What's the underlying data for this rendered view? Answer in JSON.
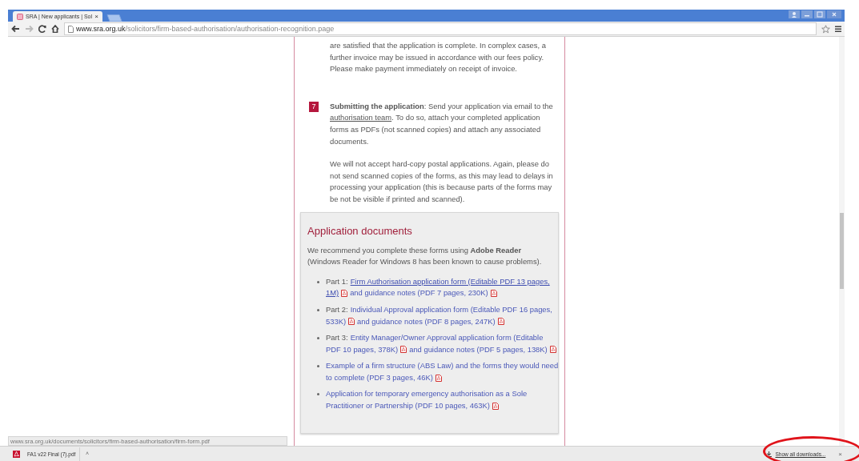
{
  "browser": {
    "tab_title": "SRA | New applicants | Sol",
    "url_host": "www.sra.org.uk",
    "url_path": "/solicitors/firm-based-authorisation/authorisation-recognition.page"
  },
  "content": {
    "intro_paragraph": "are satisfied that the application is complete. In complex cases, a further invoice may be issued in accordance with our fees policy. Please make payment immediately on receipt of invoice.",
    "step": {
      "number": "7",
      "lead": "**Submitting the application**: Send your application via email to the",
      "link": "authorisation team",
      "rest": ". To do so, attach your completed application forms as PDFs (not scanned copies) and attach any associated documents."
    },
    "step_note": "We will not accept hard-copy postal applications. Again, please do not send scanned copies of the forms, as this may lead to delays in processing your application (this is because parts of the forms may be not be visible if printed and scanned).",
    "documents": {
      "title": "Application documents",
      "intro": "We recommend you complete these forms using **Adobe Reader** (Windows Reader for Windows 8 has been known to cause problems).",
      "items": [
        {
          "lines": [
            [
              {
                "kind": "text",
                "text": "Part 1: "
              },
              {
                "kind": "link",
                "text": "Firm Authorisation application form (Editable PDF 13 pages,",
                "hover": true
              }
            ],
            [
              {
                "kind": "link",
                "text": "1M)",
                "hover": true
              },
              {
                "kind": "pdf"
              },
              {
                "kind": "link",
                "text": "and guidance notes (PDF 7 pages, 230K)",
                "hover": false
              },
              {
                "kind": "pdf"
              }
            ]
          ]
        },
        {
          "lines": [
            [
              {
                "kind": "text",
                "text": "Part 2: "
              },
              {
                "kind": "link",
                "text": "Individual Approval application form (Editable PDF 16 pages,",
                "hover": false
              }
            ],
            [
              {
                "kind": "link",
                "text": "533K)",
                "hover": false
              },
              {
                "kind": "pdf"
              },
              {
                "kind": "link",
                "text": "and guidance notes (PDF 8 pages, 247K)",
                "hover": false
              },
              {
                "kind": "pdf"
              }
            ]
          ]
        },
        {
          "lines": [
            [
              {
                "kind": "text",
                "text": "Part 3: "
              },
              {
                "kind": "link",
                "text": "Entity Manager/Owner Approval application form (Editable",
                "hover": false
              }
            ],
            [
              {
                "kind": "link",
                "text": "PDF 10 pages, 378K)",
                "hover": false
              },
              {
                "kind": "pdf"
              },
              {
                "kind": "link",
                "text": "and guidance notes (PDF 5 pages, 138K)",
                "hover": false
              },
              {
                "kind": "pdf"
              }
            ]
          ]
        },
        {
          "lines": [
            [
              {
                "kind": "link",
                "text": "Example of a firm structure (ABS Law) and the forms they would need",
                "hover": false
              }
            ],
            [
              {
                "kind": "link",
                "text": "to complete (PDF 3 pages, 46K)",
                "hover": false
              },
              {
                "kind": "pdf"
              }
            ]
          ]
        },
        {
          "lines": [
            [
              {
                "kind": "link",
                "text": "Application for temporary emergency authorisation as a Sole",
                "hover": false
              }
            ],
            [
              {
                "kind": "link",
                "text": "Practitioner or Partnership (PDF 10 pages, 463K)",
                "hover": false
              },
              {
                "kind": "pdf"
              }
            ]
          ]
        }
      ]
    }
  },
  "status_url": "www.sra.org.uk/documents/solicitors/firm-based-authorisation/firm-form.pdf",
  "downloads": {
    "file": "FA1 v22 Final (7).pdf",
    "caret": "˄",
    "show_all": "Show all downloads...",
    "close": "×"
  },
  "tab_close": "×"
}
